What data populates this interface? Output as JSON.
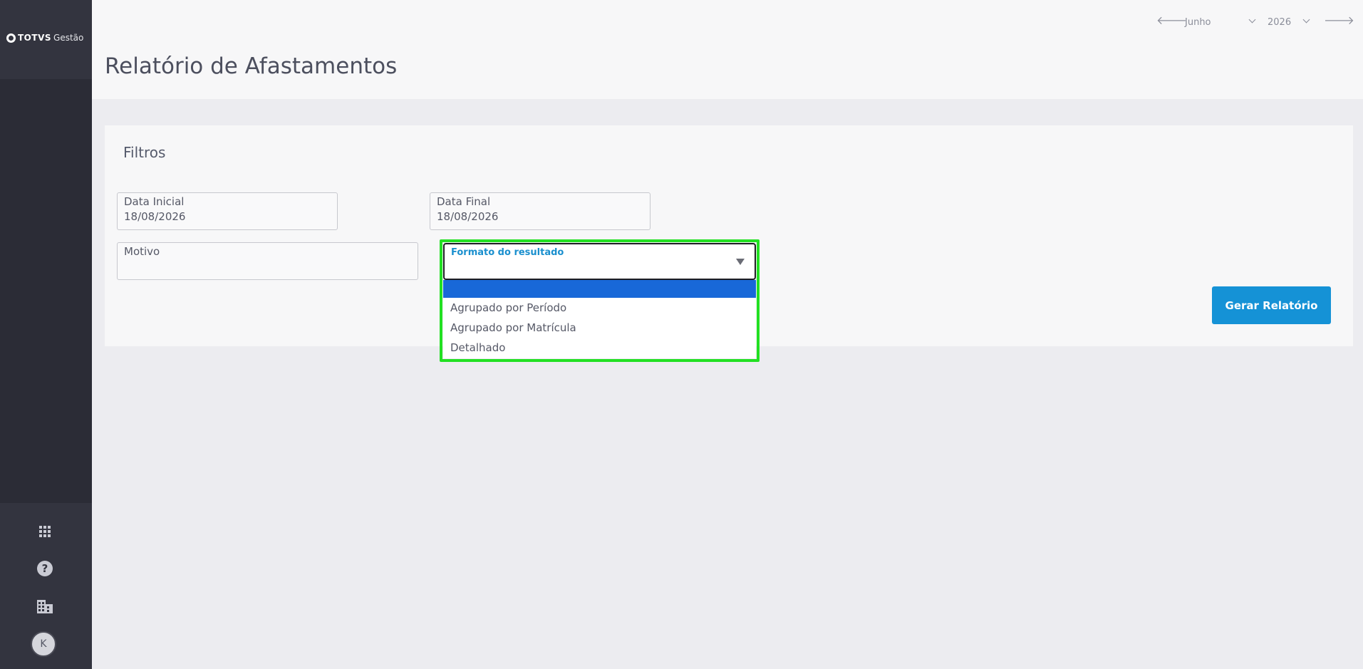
{
  "brand": {
    "name": "TOTVS",
    "product": "Gestão"
  },
  "sidebar": {
    "icons": [
      "apps-grid-icon",
      "help-icon",
      "building-icon"
    ],
    "avatar_initial": "K"
  },
  "header": {
    "title": "Relatório de Afastamentos",
    "month": "Junho",
    "year": "2026"
  },
  "filters": {
    "title": "Filtros",
    "data_inicial": {
      "label": "Data Inicial",
      "value": "18/08/2026"
    },
    "data_final": {
      "label": "Data Final",
      "value": "18/08/2026"
    },
    "motivo": {
      "label": "Motivo",
      "value": ""
    },
    "formato": {
      "label": "Formato do resultado",
      "selected": "",
      "options": [
        "",
        "Agrupado por Período",
        "Agrupado por Matrícula",
        "Detalhado"
      ]
    },
    "submit_label": "Gerar Relatório"
  },
  "colors": {
    "sidebar": "#2b2c36",
    "primary_button": "#1592d6",
    "highlight_option": "#1868d8",
    "focus_outline": "#22e022"
  }
}
